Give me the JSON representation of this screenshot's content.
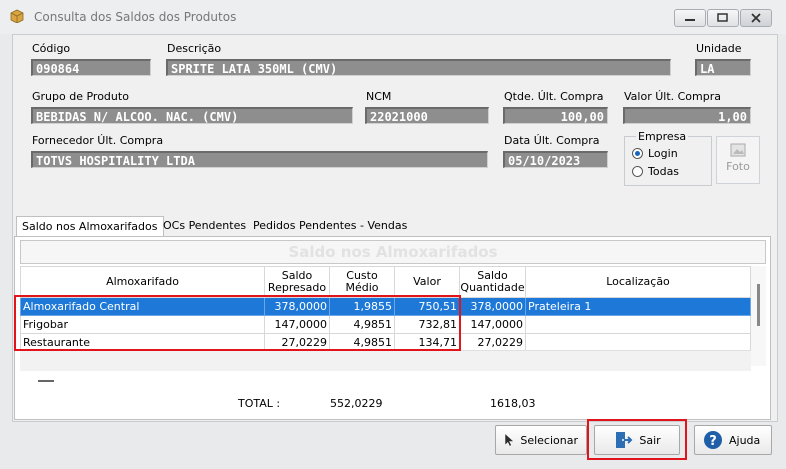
{
  "window": {
    "title": "Consulta dos Saldos dos Produtos"
  },
  "fields": {
    "codigo_label": "Código",
    "codigo": "090864",
    "descricao_label": "Descrição",
    "descricao": "SPRITE LATA 350ML (CMV)",
    "unidade_label": "Unidade",
    "unidade": "LA",
    "grupo_label": "Grupo de Produto",
    "grupo": "BEBIDAS N/ ALCOO. NAC. (CMV)",
    "ncm_label": "NCM",
    "ncm": "22021000",
    "qtde_label": "Qtde. Últ. Compra",
    "qtde": "100,00",
    "valor_label": "Valor Últ. Compra",
    "valor": "1,00",
    "fornecedor_label": "Fornecedor Últ. Compra",
    "fornecedor": "TOTVS HOSPITALITY LTDA",
    "data_label": "Data Últ. Compra",
    "data": "05/10/2023"
  },
  "empresa": {
    "label": "Empresa",
    "options": [
      "Login",
      "Todas"
    ],
    "selected": "Login"
  },
  "foto_label": "Foto",
  "tabs": [
    "Saldo nos Almoxarifados",
    "OCs Pendentes",
    "Pedidos Pendentes - Vendas"
  ],
  "panel_title": "Saldo nos Almoxarifados",
  "table": {
    "headers": [
      "Almoxarifado",
      "Saldo\nRepresado",
      "Custo\nMédio",
      "Valor",
      "Saldo\nQuantidade",
      "Localização"
    ],
    "rows": [
      [
        "Almoxarifado Central",
        "378,0000",
        "1,9855",
        "750,51",
        "378,0000",
        "Prateleira 1"
      ],
      [
        "Frigobar",
        "147,0000",
        "4,9851",
        "732,81",
        "147,0000",
        ""
      ],
      [
        "Restaurante",
        "27,0229",
        "4,9851",
        "134,71",
        "27,0229",
        ""
      ]
    ]
  },
  "totals": {
    "label": "TOTAL :",
    "saldo": "552,0229",
    "quantidade": "1618,03"
  },
  "buttons": {
    "selecionar": "Selecionar",
    "sair": "Sair",
    "ajuda": "Ajuda"
  },
  "colors": {
    "highlight": "#e0141a",
    "selection": "#1e78d7",
    "field_bg": "#8e8e8e"
  }
}
